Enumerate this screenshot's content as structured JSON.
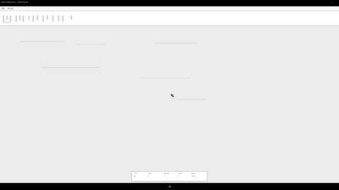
{
  "window": {
    "title": "Microsoft Excel - Workbook1",
    "menu": [
      "File",
      "Home",
      "Insert",
      "View"
    ]
  },
  "ribbon": {
    "group_label": "Clipboard"
  },
  "status_panel": {
    "columns": [
      {
        "label": "Cell",
        "value": "A1"
      },
      {
        "label": "Sum",
        "value": "0"
      },
      {
        "label": "Average",
        "value": "0"
      },
      {
        "label": "Count",
        "value": "0"
      },
      {
        "label": "Zoom",
        "value": "100%"
      }
    ]
  },
  "colors": {
    "window_bg": "#ececec",
    "ribbon_bg": "#ffffff",
    "frame": "#000000"
  }
}
